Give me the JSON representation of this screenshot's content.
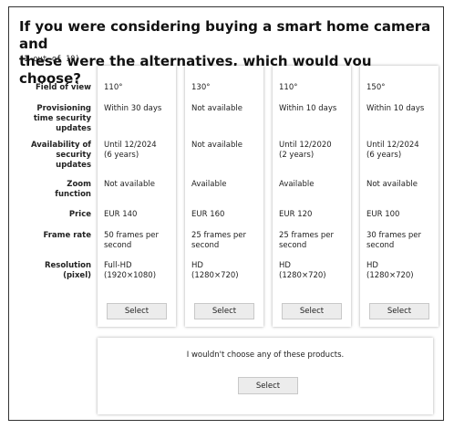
{
  "question": {
    "line1": "If you were considering buying a smart home camera and",
    "line2": "these were the alternatives, which would you choose?",
    "progress": "(1 out of 10)"
  },
  "attributes": {
    "field_of_view": "Field of view",
    "provisioning": [
      "Provisioning",
      "time security",
      "updates"
    ],
    "availability": [
      "Availability of",
      "security",
      "updates"
    ],
    "zoom": [
      "Zoom",
      "function"
    ],
    "price": "Price",
    "frame_rate": "Frame rate",
    "resolution": [
      "Resolution",
      "(pixel)"
    ]
  },
  "alternatives": [
    {
      "field_of_view": "110°",
      "provisioning": [
        "Within 30 days"
      ],
      "availability": [
        "Until 12/2024",
        "(6 years)"
      ],
      "zoom": [
        "Not available"
      ],
      "price": "EUR 140",
      "frame_rate": [
        "50 frames per",
        "second"
      ],
      "resolution": [
        "Full-HD",
        "(1920×1080)"
      ],
      "select_label": "Select"
    },
    {
      "field_of_view": "130°",
      "provisioning": [
        "Not available"
      ],
      "availability": [
        "Not available"
      ],
      "zoom": [
        "Available"
      ],
      "price": "EUR 160",
      "frame_rate": [
        "25 frames per",
        "second"
      ],
      "resolution": [
        "HD",
        "(1280×720)"
      ],
      "select_label": "Select"
    },
    {
      "field_of_view": "110°",
      "provisioning": [
        "Within 10 days"
      ],
      "availability": [
        "Until 12/2020",
        "(2 years)"
      ],
      "zoom": [
        "Available"
      ],
      "price": "EUR 120",
      "frame_rate": [
        "25 frames per",
        "second"
      ],
      "resolution": [
        "HD",
        "(1280×720)"
      ],
      "select_label": "Select"
    },
    {
      "field_of_view": "150°",
      "provisioning": [
        "Within 10 days"
      ],
      "availability": [
        "Until 12/2024",
        "(6 years)"
      ],
      "zoom": [
        "Not available"
      ],
      "price": "EUR 100",
      "frame_rate": [
        "30 frames per",
        "second"
      ],
      "resolution": [
        "HD",
        "(1280×720)"
      ],
      "select_label": "Select"
    }
  ],
  "none_option": {
    "text": "I wouldn't choose any of these products.",
    "select_label": "Select"
  }
}
